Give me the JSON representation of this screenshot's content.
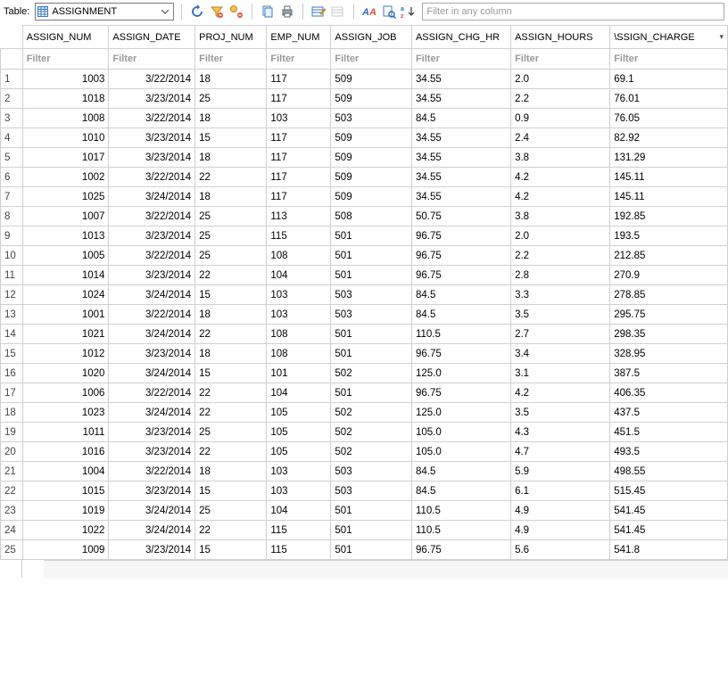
{
  "toolbar": {
    "label": "Table:",
    "selected_table": "ASSIGNMENT",
    "filter_placeholder": "Filter in any column"
  },
  "columns": [
    {
      "name": "ASSIGN_NUM",
      "align": "right",
      "filter_placeholder": "Filter"
    },
    {
      "name": "ASSIGN_DATE",
      "align": "right",
      "filter_placeholder": "Filter"
    },
    {
      "name": "PROJ_NUM",
      "align": "left",
      "filter_placeholder": "Filter"
    },
    {
      "name": "EMP_NUM",
      "align": "left",
      "filter_placeholder": "Filter"
    },
    {
      "name": "ASSIGN_JOB",
      "align": "left",
      "filter_placeholder": "Filter"
    },
    {
      "name": "ASSIGN_CHG_HR",
      "align": "left",
      "filter_placeholder": "Filter"
    },
    {
      "name": "ASSIGN_HOURS",
      "align": "left",
      "filter_placeholder": "Filter"
    },
    {
      "name": "\\SSIGN_CHARGE",
      "align": "left",
      "filter_placeholder": "Filter",
      "sorted": true
    }
  ],
  "rows": [
    [
      "1003",
      "3/22/2014",
      "18",
      "117",
      "509",
      "34.55",
      "2.0",
      "69.1"
    ],
    [
      "1018",
      "3/23/2014",
      "25",
      "117",
      "509",
      "34.55",
      "2.2",
      "76.01"
    ],
    [
      "1008",
      "3/22/2014",
      "18",
      "103",
      "503",
      "84.5",
      "0.9",
      "76.05"
    ],
    [
      "1010",
      "3/23/2014",
      "15",
      "117",
      "509",
      "34.55",
      "2.4",
      "82.92"
    ],
    [
      "1017",
      "3/23/2014",
      "18",
      "117",
      "509",
      "34.55",
      "3.8",
      "131.29"
    ],
    [
      "1002",
      "3/22/2014",
      "22",
      "117",
      "509",
      "34.55",
      "4.2",
      "145.11"
    ],
    [
      "1025",
      "3/24/2014",
      "18",
      "117",
      "509",
      "34.55",
      "4.2",
      "145.11"
    ],
    [
      "1007",
      "3/22/2014",
      "25",
      "113",
      "508",
      "50.75",
      "3.8",
      "192.85"
    ],
    [
      "1013",
      "3/23/2014",
      "25",
      "115",
      "501",
      "96.75",
      "2.0",
      "193.5"
    ],
    [
      "1005",
      "3/22/2014",
      "25",
      "108",
      "501",
      "96.75",
      "2.2",
      "212.85"
    ],
    [
      "1014",
      "3/23/2014",
      "22",
      "104",
      "501",
      "96.75",
      "2.8",
      "270.9"
    ],
    [
      "1024",
      "3/24/2014",
      "15",
      "103",
      "503",
      "84.5",
      "3.3",
      "278.85"
    ],
    [
      "1001",
      "3/22/2014",
      "18",
      "103",
      "503",
      "84.5",
      "3.5",
      "295.75"
    ],
    [
      "1021",
      "3/24/2014",
      "22",
      "108",
      "501",
      "110.5",
      "2.7",
      "298.35"
    ],
    [
      "1012",
      "3/23/2014",
      "18",
      "108",
      "501",
      "96.75",
      "3.4",
      "328.95"
    ],
    [
      "1020",
      "3/24/2014",
      "15",
      "101",
      "502",
      "125.0",
      "3.1",
      "387.5"
    ],
    [
      "1006",
      "3/22/2014",
      "22",
      "104",
      "501",
      "96.75",
      "4.2",
      "406.35"
    ],
    [
      "1023",
      "3/24/2014",
      "22",
      "105",
      "502",
      "125.0",
      "3.5",
      "437.5"
    ],
    [
      "1011",
      "3/23/2014",
      "25",
      "105",
      "502",
      "105.0",
      "4.3",
      "451.5"
    ],
    [
      "1016",
      "3/23/2014",
      "22",
      "105",
      "502",
      "105.0",
      "4.7",
      "493.5"
    ],
    [
      "1004",
      "3/22/2014",
      "18",
      "103",
      "503",
      "84.5",
      "5.9",
      "498.55"
    ],
    [
      "1015",
      "3/23/2014",
      "15",
      "103",
      "503",
      "84.5",
      "6.1",
      "515.45"
    ],
    [
      "1019",
      "3/24/2014",
      "25",
      "104",
      "501",
      "110.5",
      "4.9",
      "541.45"
    ],
    [
      "1022",
      "3/24/2014",
      "22",
      "115",
      "501",
      "110.5",
      "4.9",
      "541.45"
    ],
    [
      "1009",
      "3/23/2014",
      "15",
      "115",
      "501",
      "96.75",
      "5.6",
      "541.8"
    ]
  ]
}
